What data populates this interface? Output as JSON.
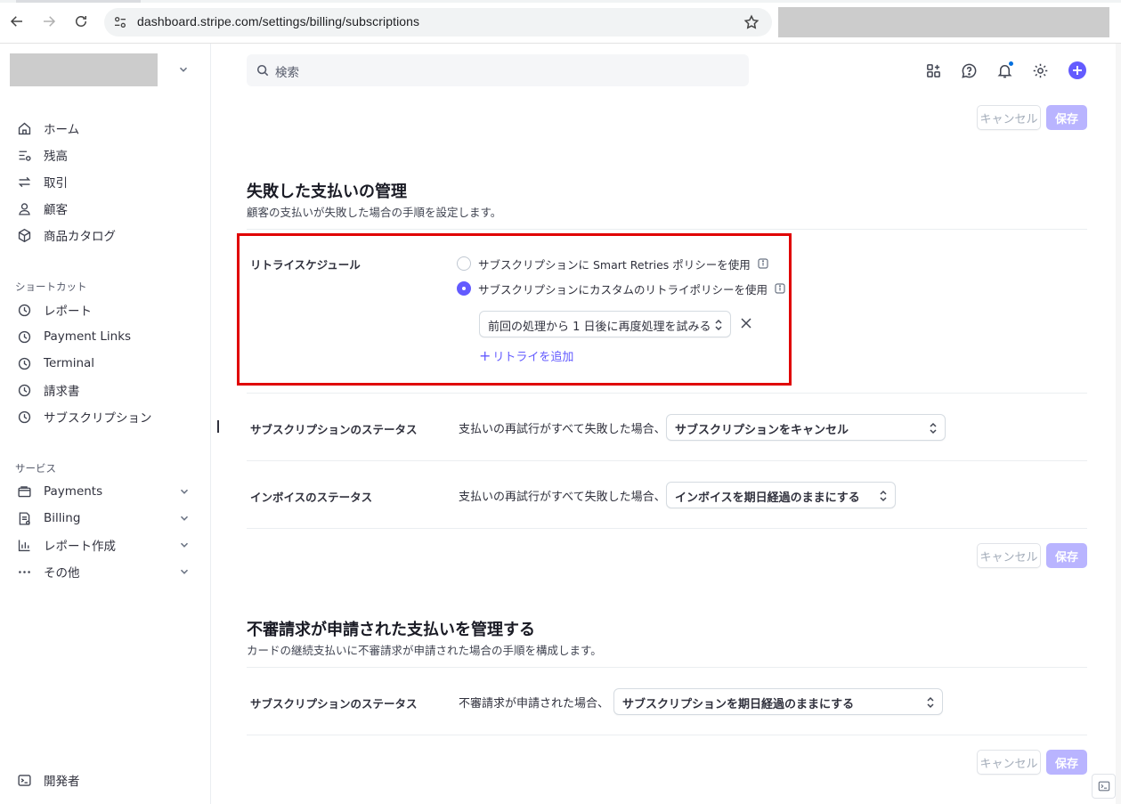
{
  "browser": {
    "url": "dashboard.stripe.com/settings/billing/subscriptions"
  },
  "sidebar": {
    "main_items": [
      {
        "label": "ホーム",
        "icon": "home-icon"
      },
      {
        "label": "残高",
        "icon": "balance-icon"
      },
      {
        "label": "取引",
        "icon": "transactions-icon"
      },
      {
        "label": "顧客",
        "icon": "customer-icon"
      },
      {
        "label": "商品カタログ",
        "icon": "product-catalog-icon"
      }
    ],
    "shortcuts_title": "ショートカット",
    "shortcuts": [
      {
        "label": "レポート",
        "icon": "clock-icon"
      },
      {
        "label": "Payment Links",
        "icon": "clock-icon"
      },
      {
        "label": "Terminal",
        "icon": "clock-icon"
      },
      {
        "label": "請求書",
        "icon": "clock-icon"
      },
      {
        "label": "サブスクリプション",
        "icon": "clock-icon"
      }
    ],
    "services_title": "サービス",
    "services": [
      {
        "label": "Payments",
        "icon": "payments-icon"
      },
      {
        "label": "Billing",
        "icon": "billing-icon"
      },
      {
        "label": "レポート作成",
        "icon": "reporting-icon"
      },
      {
        "label": "その他",
        "icon": "more-icon"
      }
    ],
    "developer": {
      "label": "開発者",
      "icon": "terminal-icon"
    }
  },
  "topbar": {
    "search_placeholder": "検索"
  },
  "buttons": {
    "cancel": "キャンセル",
    "save": "保存"
  },
  "failed_payments": {
    "title": "失敗した支払いの管理",
    "subtitle": "顧客の支払いが失敗した場合の手順を設定します。",
    "retry_schedule": {
      "label": "リトライスケジュール",
      "option_smart": "サブスクリプションに Smart Retries ポリシーを使用",
      "option_custom": "サブスクリプションにカスタムのリトライポリシーを使用",
      "selected": "custom",
      "retry_select": "前回の処理から 1 日後に再度処理を試みる",
      "add_retry": "リトライを追加"
    },
    "subscription_status": {
      "label": "サブスクリプションのステータス",
      "condition": "支払いの再試行がすべて失敗した場合、",
      "value": "サブスクリプションをキャンセル"
    },
    "invoice_status": {
      "label": "インボイスのステータス",
      "condition": "支払いの再試行がすべて失敗した場合、",
      "value": "インボイスを期日経過のままにする"
    }
  },
  "disputes": {
    "title": "不審請求が申請された支払いを管理する",
    "subtitle": "カードの継続支払いに不審請求が申請された場合の手順を構成します。",
    "subscription_status": {
      "label": "サブスクリプションのステータス",
      "condition": "不審請求が申請された場合、",
      "value": "サブスクリプションを期日経過のままにする"
    }
  },
  "colors": {
    "accent": "#635bff",
    "save_disabled": "#b9b4ff",
    "highlight": "#e00000"
  }
}
